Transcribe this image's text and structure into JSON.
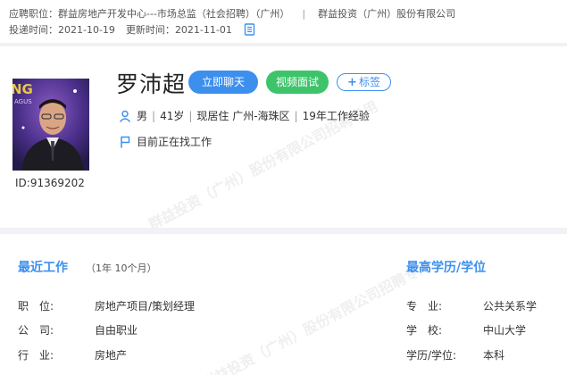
{
  "header": {
    "apply_label": "应聘职位：",
    "position": "群益房地产开发中心---市场总监（社会招聘）（广州）",
    "separator": "|",
    "company": "群益投资（广州）股份有限公司",
    "deliver_label": "投递时间：",
    "deliver_time": "2021-10-19",
    "update_label": "更新时间：",
    "update_time": "2021-11-01"
  },
  "candidate": {
    "name": "罗沛超",
    "id_text": "ID:91369202",
    "gender": "男",
    "age": "41岁",
    "location": "现居住 广州-海珠区",
    "experience": "19年工作经验",
    "status": "目前正在找工作"
  },
  "actions": {
    "chat": "立即聊天",
    "video": "视频面试",
    "tag": "标签"
  },
  "watermark": {
    "text1": "群益投资（广州）股份有限公司招聘专用",
    "text2": "群益投资（广州）股份有限公司招聘专用"
  },
  "recent_work": {
    "title": "最近工作",
    "duration": "（1年 10个月）",
    "rows": [
      {
        "label": "职　位:",
        "value": "房地产项目/策划经理"
      },
      {
        "label": "公　司:",
        "value": "自由职业"
      },
      {
        "label": "行　业:",
        "value": "房地产"
      }
    ]
  },
  "education": {
    "title": "最高学历/学位",
    "rows": [
      {
        "label": "专　业:",
        "value": "公共关系学"
      },
      {
        "label": "学　校:",
        "value": "中山大学"
      },
      {
        "label": "学历/学位:",
        "value": "本科"
      }
    ]
  },
  "colors": {
    "accent": "#3d8fee",
    "green": "#3dc46b"
  }
}
